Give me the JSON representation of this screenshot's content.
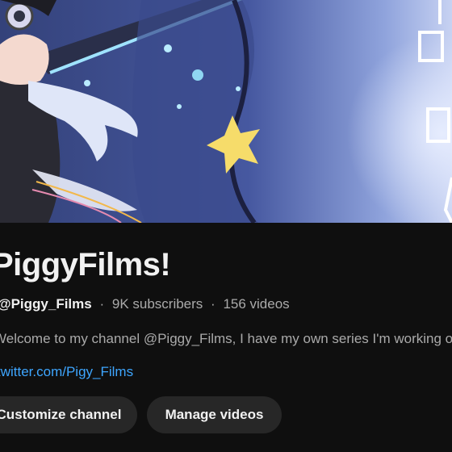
{
  "channel": {
    "name": "PiggyFilms!",
    "handle": "@Piggy_Films",
    "subscribers": "9K subscribers",
    "videos": "156 videos",
    "separator": "·",
    "description": "Welcome to my channel @Piggy_Films, I have my own series I'm working on",
    "link": "twitter.com/Pigy_Films"
  },
  "actions": {
    "customize_label": "Customize channel",
    "manage_label": "Manage videos"
  },
  "colors": {
    "background": "#0f0f0f",
    "button_bg": "#272727",
    "link": "#3ea6ff",
    "secondary_text": "#aaaaaa",
    "banner_sky": "#3f4f8f",
    "star": "#f6dc6a"
  }
}
